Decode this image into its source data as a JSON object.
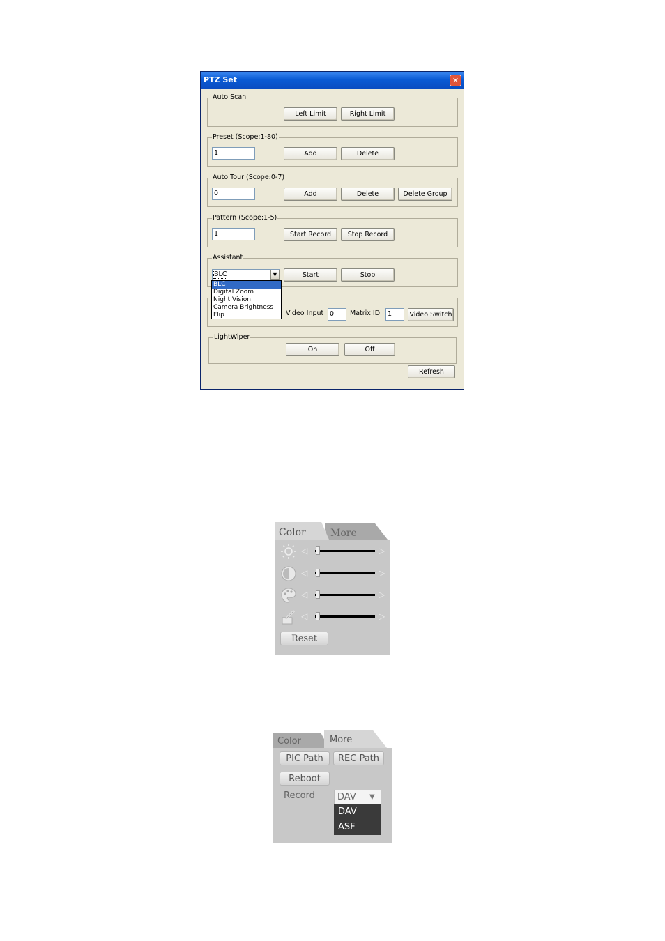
{
  "ptz": {
    "title": "PTZ Set",
    "close": "✕",
    "auto_scan": {
      "legend": "Auto Scan",
      "left_limit": "Left Limit",
      "right_limit": "Right Limit"
    },
    "preset": {
      "legend": "Preset (Scope:1-80)",
      "value": "1",
      "add": "Add",
      "delete": "Delete"
    },
    "auto_tour": {
      "legend": "Auto Tour (Scope:0-7)",
      "value": "0",
      "add": "Add",
      "delete": "Delete",
      "delete_group": "Delete Group"
    },
    "pattern": {
      "legend": "Pattern (Scope:1-5)",
      "value": "1",
      "start_record": "Start Record",
      "stop_record": "Stop Record"
    },
    "assistant": {
      "legend": "Assistant",
      "selected": "BLC",
      "arrow": "▼",
      "start": "Start",
      "stop": "Stop",
      "options": [
        "BLC",
        "Digital Zoom",
        "Night Vision",
        "Camera Brightness",
        "Flip"
      ]
    },
    "matrix": {
      "video_input_label": "Video Input",
      "video_input_value": "0",
      "matrix_id_label": "Matrix ID",
      "matrix_id_value": "1",
      "video_switch": "Video Switch"
    },
    "light_wiper": {
      "legend": "LightWiper",
      "on": "On",
      "off": "Off"
    },
    "refresh": "Refresh"
  },
  "color_panel": {
    "tabs": [
      "Color",
      "More"
    ],
    "active_tab": "Color",
    "sliders": [
      {
        "icon": "brightness-icon",
        "level": 0
      },
      {
        "icon": "contrast-icon",
        "level": 0
      },
      {
        "icon": "palette-icon",
        "level": 0
      },
      {
        "icon": "saturation-icon",
        "level": 0
      }
    ],
    "arrow_left": "◁",
    "arrow_right": "▷",
    "reset": "Reset"
  },
  "more_panel": {
    "tabs": [
      "Color",
      "More"
    ],
    "active_tab": "More",
    "pic_path": "PIC Path",
    "rec_path": "REC Path",
    "reboot": "Reboot",
    "record_label": "Record",
    "record_selected": "DAV",
    "arrow": "▼",
    "record_options": [
      "DAV",
      "ASF"
    ]
  }
}
